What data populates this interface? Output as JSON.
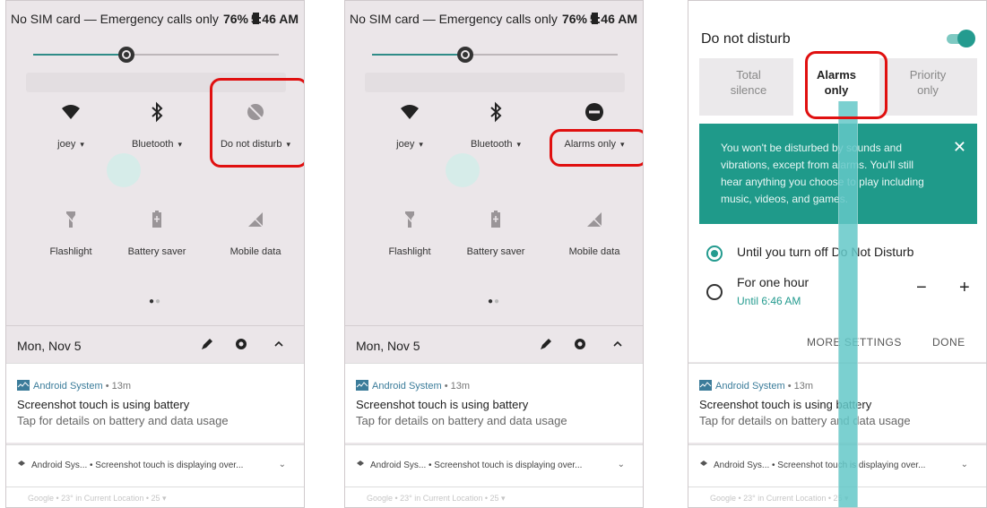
{
  "colors": {
    "accent": "#249b8f",
    "highlight": "#e01010",
    "teal_panel": "#1f9a8a"
  },
  "status_bar": {
    "carrier": "No SIM card — Emergency calls only",
    "battery": "76%",
    "time": "5:46 AM"
  },
  "panel1": {
    "tiles": [
      {
        "icon": "wifi-icon",
        "label": "joey",
        "caret": "▾"
      },
      {
        "icon": "bluetooth-icon",
        "label": "Bluetooth",
        "caret": "▾"
      },
      {
        "icon": "do-not-disturb-off-icon",
        "label": "Do not disturb",
        "caret": "▾"
      },
      {
        "icon": "flashlight-icon",
        "label": "Flashlight"
      },
      {
        "icon": "battery-saver-icon",
        "label": "Battery saver"
      },
      {
        "icon": "mobile-data-icon",
        "label": "Mobile data"
      }
    ]
  },
  "panel2": {
    "tiles": [
      {
        "icon": "wifi-icon",
        "label": "joey",
        "caret": "▾"
      },
      {
        "icon": "bluetooth-icon",
        "label": "Bluetooth",
        "caret": "▾"
      },
      {
        "icon": "do-not-disturb-on-icon",
        "label": "Alarms only",
        "caret": "▾"
      },
      {
        "icon": "flashlight-icon",
        "label": "Flashlight"
      },
      {
        "icon": "battery-saver-icon",
        "label": "Battery saver"
      },
      {
        "icon": "mobile-data-icon",
        "label": "Mobile data"
      }
    ]
  },
  "pager": {
    "dot_on": "●",
    "dot_off": "●"
  },
  "date_bar": {
    "date": "Mon, Nov 5"
  },
  "notification": {
    "app": "Android System",
    "meta": " • 13m",
    "title": "Screenshot touch is using battery",
    "subtitle": "Tap for details on battery and data usage"
  },
  "notification2": {
    "text": "Android Sys... • Screenshot touch is displaying over...",
    "chevron": "⌄"
  },
  "notification3": {
    "text": "Google • 23° in Current Location • 25 ▾"
  },
  "dnd": {
    "title": "Do not disturb",
    "toggle_on": true,
    "options": [
      {
        "line1": "Total",
        "line2": "silence"
      },
      {
        "line1": "Alarms",
        "line2": "only",
        "selected": true
      },
      {
        "line1": "Priority",
        "line2": "only"
      }
    ],
    "info_text": "You won't be disturbed by sounds and vibrations, except from alarms. You'll still hear anything you choose to play including music, videos, and games.",
    "close": "✕",
    "duration_opt1": "Until you turn off Do Not Disturb",
    "duration_opt2": "For one hour",
    "duration_opt2_sub": "Until 6:46 AM",
    "minus": "−",
    "plus": "+",
    "more_settings": "MORE SETTINGS",
    "done": "DONE"
  }
}
